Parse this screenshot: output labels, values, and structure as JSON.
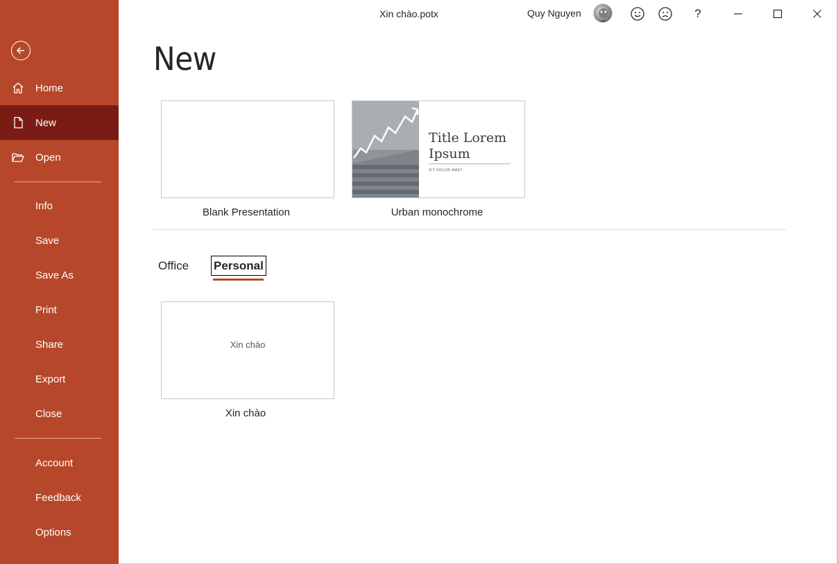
{
  "window": {
    "title": "Xin chào.potx",
    "user_name": "Quy Nguyen",
    "help_label": "?"
  },
  "icons": {
    "back": "back-arrow-icon",
    "home": "home-icon",
    "new": "new-document-icon",
    "open": "folder-open-icon",
    "smile": "smile-icon",
    "frown": "frown-icon",
    "minimize": "minimize-icon",
    "maximize": "maximize-icon",
    "close": "close-icon"
  },
  "sidebar": {
    "items": [
      {
        "label": "Home"
      },
      {
        "label": "New"
      },
      {
        "label": "Open"
      },
      {
        "label": "Info"
      },
      {
        "label": "Save"
      },
      {
        "label": "Save As"
      },
      {
        "label": "Print"
      },
      {
        "label": "Share"
      },
      {
        "label": "Export"
      },
      {
        "label": "Close"
      },
      {
        "label": "Account"
      },
      {
        "label": "Feedback"
      },
      {
        "label": "Options"
      }
    ]
  },
  "main": {
    "page_title": "New",
    "featured": [
      {
        "label": "Blank Presentation"
      },
      {
        "label": "Urban monochrome",
        "thumb_title": "Title Lorem Ipsum",
        "thumb_subtitle": "SIT DOLOR AMET"
      }
    ],
    "tabs": [
      {
        "label": "Office"
      },
      {
        "label": "Personal"
      }
    ],
    "selected_tab": "Personal",
    "personal_templates": [
      {
        "label": "Xin chào",
        "thumb_text": "Xin chào"
      }
    ]
  },
  "colors": {
    "accent": "#b7472a",
    "sidebar_active": "#7b1c14"
  }
}
